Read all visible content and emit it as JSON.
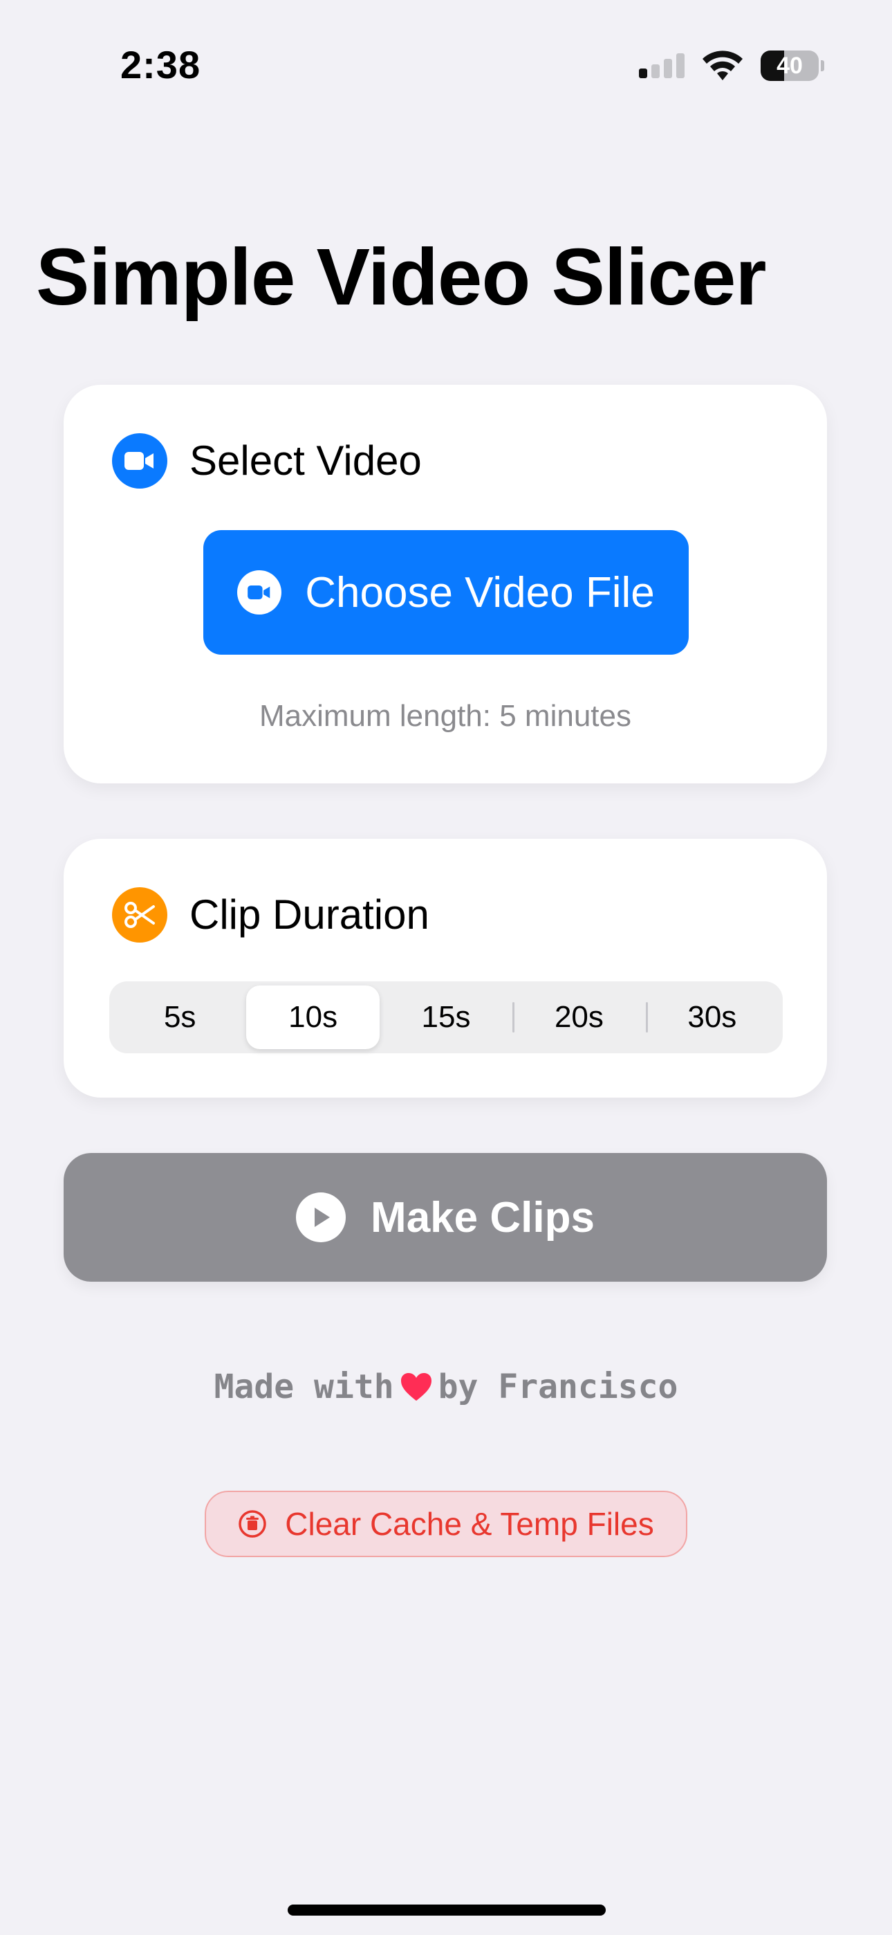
{
  "status_bar": {
    "time": "2:38",
    "battery_level": "40",
    "battery_fraction": 0.4,
    "signal_bars_active": 1,
    "signal_bars_total": 4
  },
  "app": {
    "title": "Simple Video Slicer"
  },
  "select_video": {
    "header_label": "Select Video",
    "header_icon": "video-camera-icon",
    "button_label": "Choose Video File",
    "button_icon": "video-camera-icon",
    "note": "Maximum length: 5 minutes"
  },
  "clip_duration": {
    "header_label": "Clip Duration",
    "header_icon": "scissors-icon",
    "options": [
      "5s",
      "10s",
      "15s",
      "20s",
      "30s"
    ],
    "selected": "10s"
  },
  "make_clips": {
    "label": "Make Clips",
    "icon": "play-icon"
  },
  "footer": {
    "credit_prefix": "Made with",
    "credit_suffix": "by Francisco",
    "heart_icon": "heart-icon",
    "clear_cache_label": "Clear Cache & Temp Files",
    "clear_cache_icon": "trash-icon"
  },
  "colors": {
    "background": "#f2f1f6",
    "accent_blue": "#0a7aff",
    "accent_orange": "#ff9500",
    "disabled_gray": "#8e8e93",
    "destructive_red": "#e8372e",
    "heart_red": "#ff2d55"
  }
}
